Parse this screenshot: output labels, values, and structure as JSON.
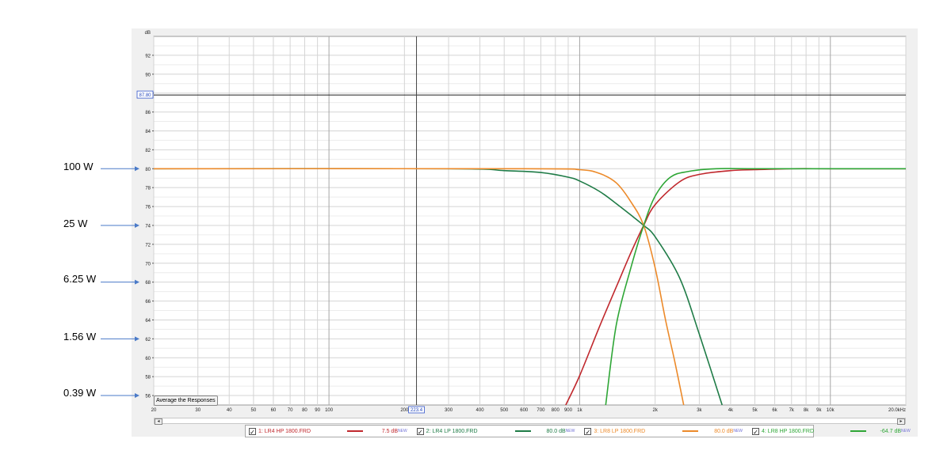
{
  "annotations": [
    {
      "label": "100 W",
      "db": 80
    },
    {
      "label": "25 W",
      "db": 74
    },
    {
      "label": "6.25 W",
      "db": 68
    },
    {
      "label": "1.56 W",
      "db": 62
    },
    {
      "label": "0.39 W",
      "db": 56
    }
  ],
  "controls": {
    "average_button": "Average the Responses",
    "cursor_freq": "223.4",
    "cursor_db": "87.80"
  },
  "legend": [
    {
      "name": "1: LR4 HP 1800.FRD",
      "value": "7.5 dB",
      "new": "NEW",
      "color": "#c0282d"
    },
    {
      "name": "2: LR4 LP 1800.FRD",
      "value": "80.0 dB",
      "new": "NEW",
      "color": "#1e7b46"
    },
    {
      "name": "3: LR8 LP 1800.FRD",
      "value": "80.0 dB",
      "new": "NEW",
      "color": "#ec8a2a"
    },
    {
      "name": "4: LR8 HP 1800.FRD",
      "value": "-64.7 dB",
      "new": "NEW",
      "color": "#2ea636"
    }
  ],
  "chart_data": {
    "type": "line",
    "xscale": "log",
    "xlim": [
      20,
      20000
    ],
    "ylim": [
      55,
      94
    ],
    "ylabel": "dB",
    "xunit_label": "20.0kHz",
    "yticks": [
      56,
      58,
      60,
      62,
      64,
      66,
      68,
      70,
      72,
      74,
      76,
      78,
      80,
      82,
      84,
      86,
      88,
      90,
      92
    ],
    "ytick_labels": [
      "56",
      "58",
      "60",
      "62",
      "64",
      "66",
      "68",
      "70",
      "72",
      "74",
      "76",
      "78",
      "80",
      "82",
      "84",
      "86",
      "88",
      "90",
      "92"
    ],
    "xticks": [
      20,
      30,
      40,
      50,
      60,
      70,
      80,
      90,
      100,
      200,
      300,
      400,
      500,
      600,
      700,
      800,
      900,
      1000,
      2000,
      3000,
      4000,
      5000,
      6000,
      7000,
      8000,
      9000,
      10000,
      20000
    ],
    "xtick_labels": [
      "20",
      "30",
      "40",
      "50",
      "60",
      "70",
      "80",
      "90",
      "100",
      "200",
      "300",
      "400",
      "500",
      "600",
      "700",
      "800",
      "900",
      "1k",
      "2k",
      "3k",
      "4k",
      "5k",
      "6k",
      "7k",
      "8k",
      "9k",
      "10k",
      "20.0kHz"
    ],
    "cursor": {
      "x": 223.4,
      "y": 87.8
    },
    "series": [
      {
        "name": "1: LR4 HP 1800.FRD",
        "color": "#c0282d",
        "x": [
          880,
          1000,
          1200,
          1400,
          1600,
          1800,
          2000,
          2500,
          3000,
          4000,
          5000,
          7000,
          10000,
          20000
        ],
        "y": [
          55,
          58.1,
          63.3,
          67.5,
          71.1,
          74,
          76.2,
          78.6,
          79.4,
          79.8,
          79.9,
          80,
          80,
          80
        ]
      },
      {
        "name": "2: LR4 LP 1800.FRD",
        "color": "#1e7b46",
        "x": [
          20,
          300,
          500,
          700,
          900,
          1000,
          1200,
          1400,
          1600,
          1800,
          2000,
          2500,
          3000,
          3700
        ],
        "y": [
          80,
          80,
          79.8,
          79.6,
          79.1,
          78.7,
          77.6,
          76.3,
          75.1,
          74,
          72.8,
          68.5,
          62.5,
          55
        ]
      },
      {
        "name": "3: LR8 LP 1800.FRD",
        "color": "#ec8a2a",
        "x": [
          20,
          600,
          1000,
          1200,
          1400,
          1600,
          1800,
          2000,
          2200,
          2400,
          2600
        ],
        "y": [
          80,
          80,
          79.9,
          79.5,
          78.5,
          76.5,
          74,
          69.5,
          64,
          59.5,
          55
        ]
      },
      {
        "name": "4: LR8 HP 1800.FRD",
        "color": "#2ea636",
        "x": [
          1270,
          1400,
          1600,
          1800,
          2000,
          2300,
          2700,
          3500,
          5000,
          20000
        ],
        "y": [
          55,
          63.5,
          69.5,
          74,
          77.1,
          79.1,
          79.7,
          80,
          80,
          80
        ]
      }
    ]
  }
}
